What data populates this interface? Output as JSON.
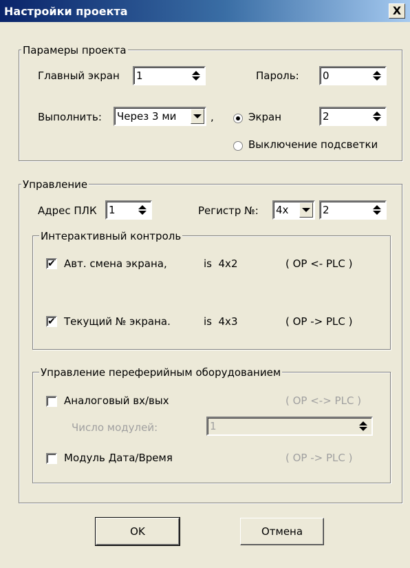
{
  "window": {
    "title": "Настройки проекта",
    "close_glyph": "X"
  },
  "project_params": {
    "legend": "Парамеры проекта",
    "main_screen_label": "Главный экран",
    "main_screen_value": "1",
    "password_label": "Пароль:",
    "password_value": "0",
    "execute_label": "Выполнить:",
    "execute_value": "Через 3 ми",
    "comma": ",",
    "radio_screen_label": "Экран",
    "screen_value": "2",
    "radio_backlight_label": "Выключение подсветки"
  },
  "control": {
    "legend": "Управление",
    "plc_address_label": "Адрес ПЛК",
    "plc_address_value": "1",
    "register_label": "Регистр №:",
    "register_type": "4x",
    "register_value": "2",
    "interactive": {
      "legend": "Интерактивный контроль",
      "row1": {
        "label": "Авт. смена экрана,",
        "is": "is  4x2",
        "direction": "( OP <- PLC )",
        "checked": true
      },
      "row2": {
        "label": "Текущий № экрана.",
        "is": "is  4x3",
        "direction": "( OP -> PLC )",
        "checked": true
      }
    },
    "peripheral": {
      "legend": "Управление переферийным оборудованием",
      "analog_label": "Аналоговый вх/вых",
      "analog_direction": "( OP <-> PLC )",
      "modules_label": "Число модулей:",
      "modules_value": "1",
      "datetime_label": "Модуль Дата/Время",
      "datetime_direction": "( OP -> PLC )"
    }
  },
  "buttons": {
    "ok": "OK",
    "cancel": "Отмена"
  },
  "colors": {
    "title_start": "#0a246a",
    "title_end": "#a6caf0",
    "dialog_bg": "#ece9d8"
  }
}
